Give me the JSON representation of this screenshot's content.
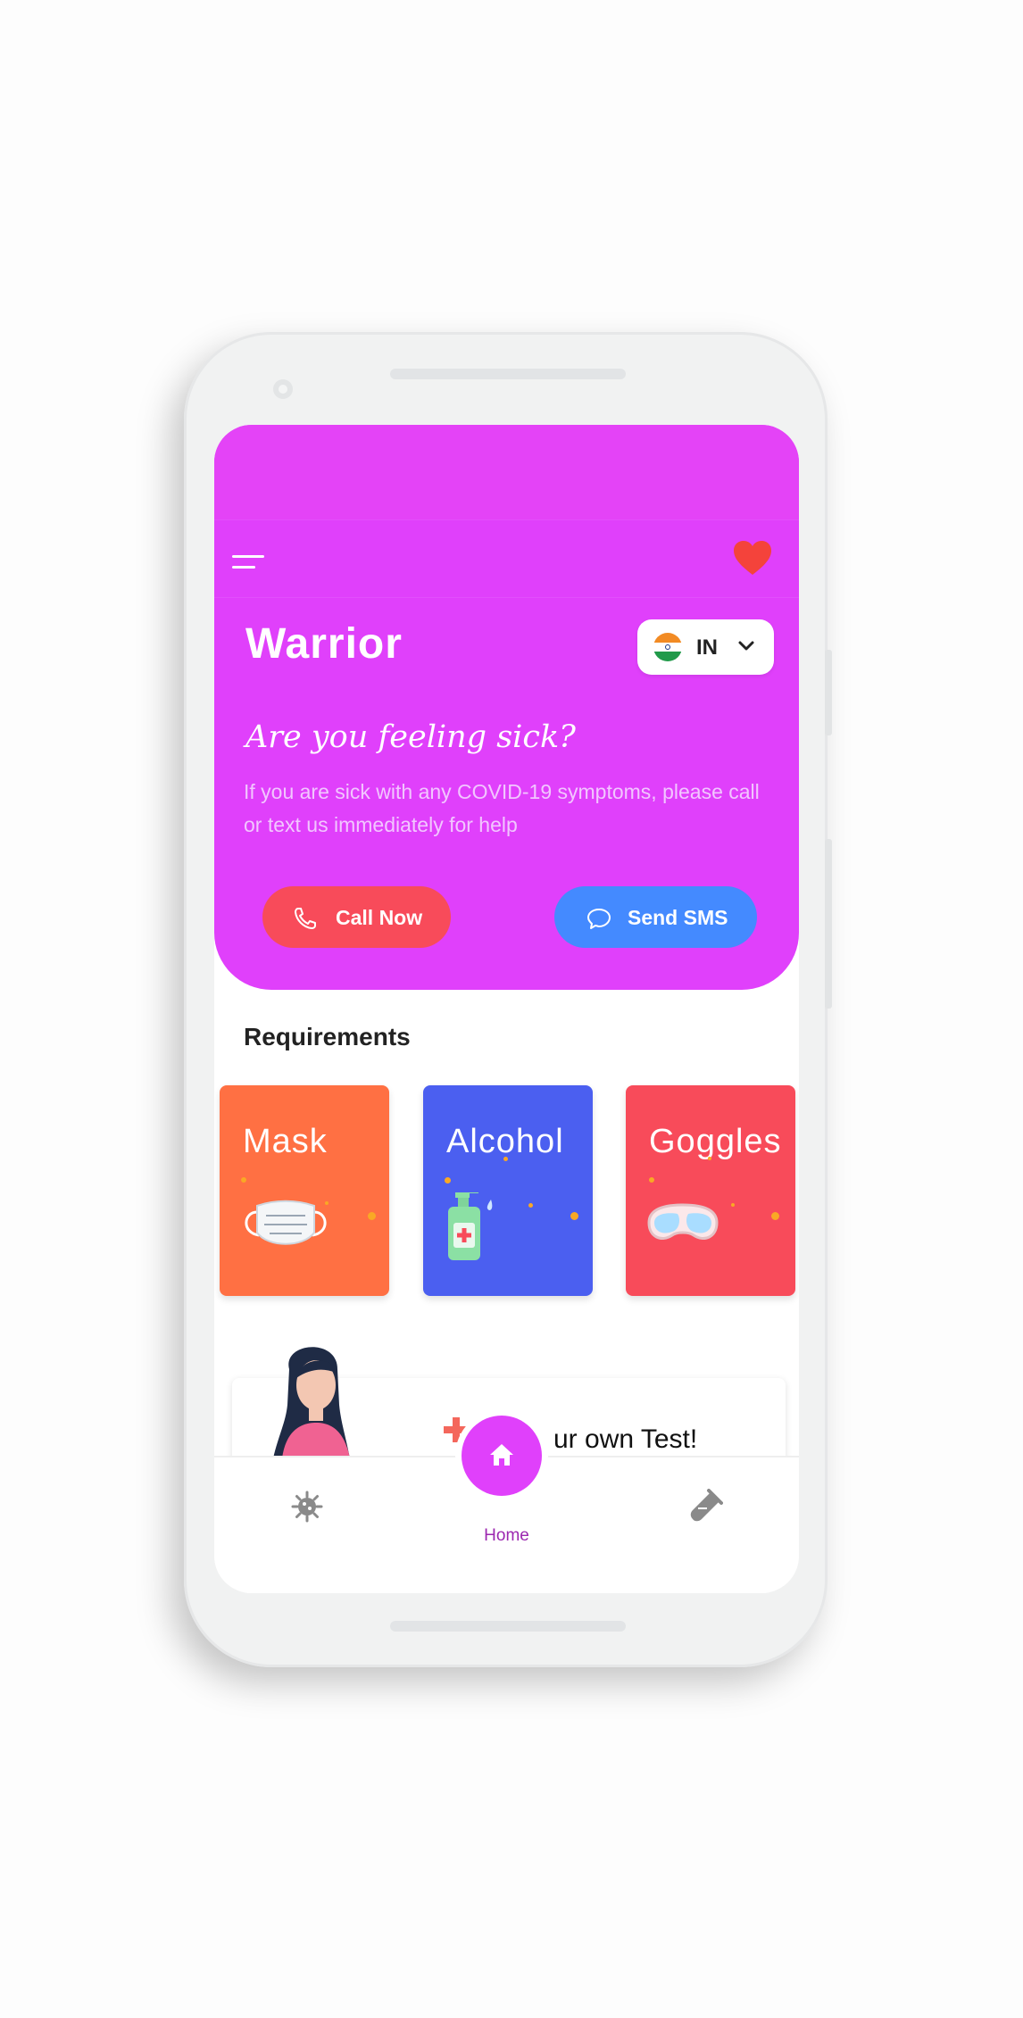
{
  "app": {
    "title": "Warrior",
    "country_code": "IN"
  },
  "hero": {
    "heading": "Are you feeling sick?",
    "description": "If you are sick with any COVID-19 symptoms, please call or text us immediately for help",
    "call_button": "Call Now",
    "sms_button": "Send SMS"
  },
  "requirements": {
    "title": "Requirements",
    "items": [
      {
        "label": "Mask",
        "icon": "mask-icon",
        "color": "#ff7043"
      },
      {
        "label": "Alcohol",
        "icon": "sanitizer-icon",
        "color": "#4b5ff0"
      },
      {
        "label": "Goggles",
        "icon": "goggles-icon",
        "color": "#f84b5a"
      }
    ]
  },
  "test_banner": {
    "text": "ur own Test!"
  },
  "bottom_nav": {
    "home_label": "Home",
    "items": [
      "virus-icon",
      "home-icon",
      "test-tube-icon"
    ]
  },
  "colors": {
    "primary": "#e040fb",
    "call": "#f84b5a",
    "sms": "#448aff"
  }
}
